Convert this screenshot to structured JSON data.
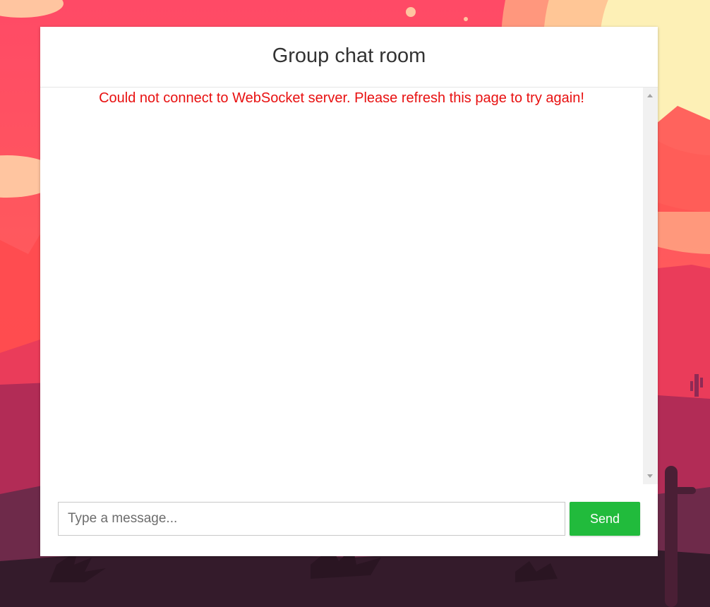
{
  "background": {
    "scene": "desert-sunset",
    "colors": {
      "sky_top": "#ff4e64",
      "sky_mid": "#ff6a5c",
      "sun": "#fdf0b6",
      "mountains_far": "#e8395a",
      "mountains_mid": "#b82c55",
      "ground_dark": "#3a1c2c"
    }
  },
  "chat": {
    "title": "Group chat room",
    "error_message": "Could not connect to WebSocket server. Please refresh this page to try again!",
    "input": {
      "value": "",
      "placeholder": "Type a message..."
    },
    "send_label": "Send",
    "colors": {
      "error": "#e81010",
      "send_button": "#21bb3c"
    }
  },
  "icons": {
    "scroll_up": "scroll-up-arrow-icon",
    "scroll_down": "scroll-down-arrow-icon"
  }
}
